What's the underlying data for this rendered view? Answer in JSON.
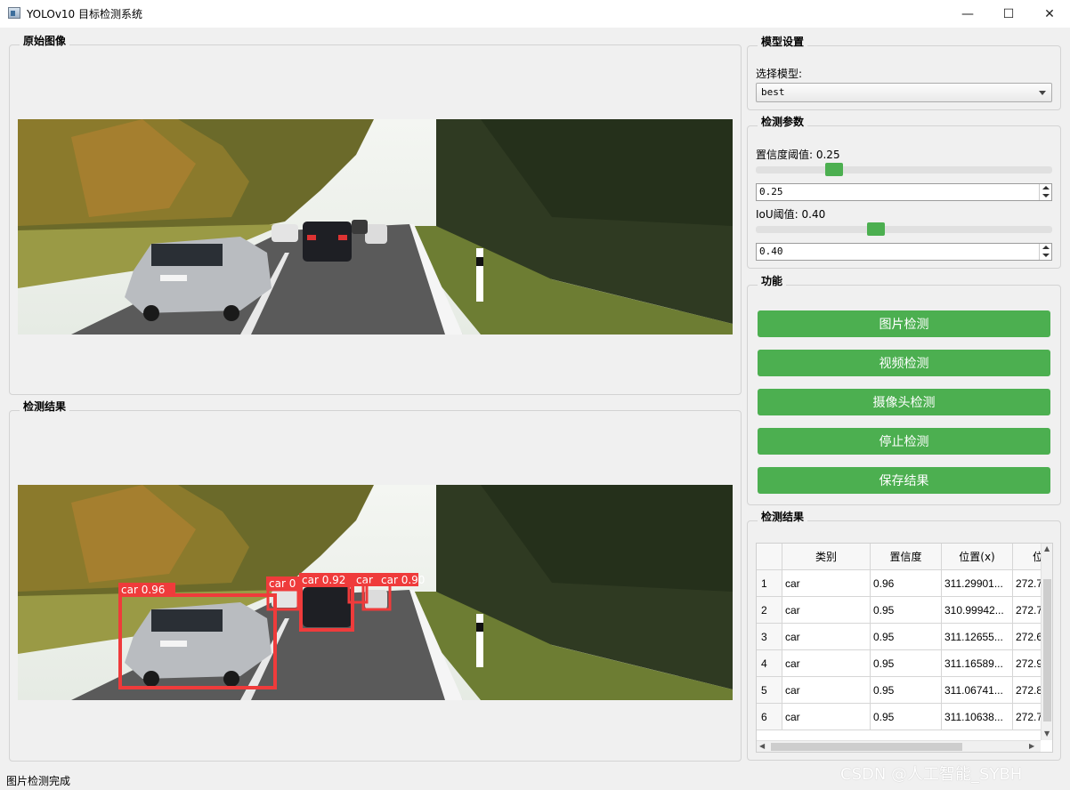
{
  "window": {
    "title": "YOLOv10 目标检测系统",
    "minimize_glyph": "—",
    "maximize_glyph": "☐",
    "close_glyph": "✕"
  },
  "original_panel": {
    "title": "原始图像"
  },
  "result_panel": {
    "title": "检测结果",
    "detections": [
      {
        "label": "car 0.96"
      },
      {
        "label": "car 0"
      },
      {
        "label": "car 0.92"
      },
      {
        "label": "car"
      },
      {
        "label": "car 0.90"
      }
    ]
  },
  "model_settings": {
    "title": "模型设置",
    "select_label": "选择模型:",
    "selected_model": "best"
  },
  "detection_params": {
    "title": "检测参数",
    "confidence": {
      "label": "置信度阈值: 0.25",
      "value": "0.25",
      "level": 0.25
    },
    "iou": {
      "label": "IoU阈值: 0.40",
      "value": "0.40",
      "level": 0.4
    }
  },
  "functions": {
    "title": "功能",
    "buttons": [
      "图片检测",
      "视频检测",
      "摄像头检测",
      "停止检测",
      "保存结果"
    ]
  },
  "results_table": {
    "title": "检测结果",
    "headers": [
      "类别",
      "置信度",
      "位置(x)",
      "位"
    ],
    "rows": [
      {
        "index": "1",
        "cls": "car",
        "conf": "0.96",
        "x": "311.29901...",
        "y": "272.7"
      },
      {
        "index": "2",
        "cls": "car",
        "conf": "0.95",
        "x": "310.99942...",
        "y": "272.7"
      },
      {
        "index": "3",
        "cls": "car",
        "conf": "0.95",
        "x": "311.12655...",
        "y": "272.6"
      },
      {
        "index": "4",
        "cls": "car",
        "conf": "0.95",
        "x": "311.16589...",
        "y": "272.9"
      },
      {
        "index": "5",
        "cls": "car",
        "conf": "0.95",
        "x": "311.06741...",
        "y": "272.8"
      },
      {
        "index": "6",
        "cls": "car",
        "conf": "0.95",
        "x": "311.10638...",
        "y": "272.7"
      }
    ]
  },
  "status_bar": {
    "text": "图片检测完成"
  },
  "watermark": "CSDN @人工智能_SYBH",
  "colors": {
    "accent": "#4caf50",
    "detection_box": "#ef3b3b"
  }
}
